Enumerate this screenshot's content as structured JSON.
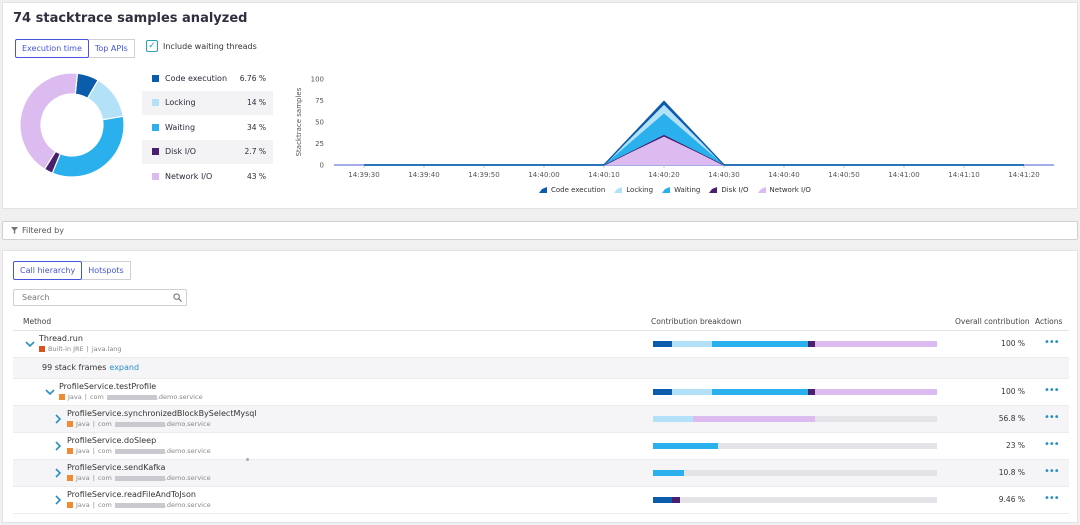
{
  "title": "74 stacktrace samples analyzed",
  "view_tabs": [
    {
      "label": "Execution time",
      "active": true
    },
    {
      "label": "Top APIs",
      "active": false
    }
  ],
  "include_waiting": {
    "label": "Include waiting threads",
    "checked": true
  },
  "categories": [
    {
      "name": "Code execution",
      "value": "6.76 %",
      "pct": 6.76,
      "color": "#0b5cab"
    },
    {
      "name": "Locking",
      "value": "14 %",
      "pct": 14,
      "color": "#b3e1f7"
    },
    {
      "name": "Waiting",
      "value": "34 %",
      "pct": 34,
      "color": "#2ab0ec"
    },
    {
      "name": "Disk I/O",
      "value": "2.7 %",
      "pct": 2.7,
      "color": "#4a1f6e"
    },
    {
      "name": "Network I/O",
      "value": "43 %",
      "pct": 43,
      "color": "#dcbcf0"
    }
  ],
  "chart_data": {
    "type": "area",
    "ylabel": "Stacktrace samples",
    "ylim": [
      0,
      100
    ],
    "yticks": [
      "100",
      "75",
      "50",
      "25",
      "0"
    ],
    "x": [
      "14:39:30",
      "14:39:40",
      "14:39:50",
      "14:40:00",
      "14:40:10",
      "14:40:20",
      "14:40:30",
      "14:40:40",
      "14:40:50",
      "14:41:00",
      "14:41:10",
      "14:41:20"
    ],
    "series": [
      {
        "name": "Network I/O",
        "values": [
          0,
          0,
          0,
          0,
          0,
          33,
          0,
          0,
          0,
          0,
          0,
          0
        ]
      },
      {
        "name": "Disk I/O",
        "values": [
          0,
          0,
          0,
          0,
          0,
          2,
          0,
          0,
          0,
          0,
          0,
          0
        ]
      },
      {
        "name": "Waiting",
        "values": [
          0,
          0,
          0,
          0,
          0,
          25,
          0,
          0,
          0,
          0,
          0,
          0
        ]
      },
      {
        "name": "Locking",
        "values": [
          0,
          0,
          0,
          0,
          0,
          10,
          0,
          0,
          0,
          0,
          0,
          0
        ]
      },
      {
        "name": "Code execution",
        "values": [
          0,
          0,
          0,
          0,
          0,
          4,
          0,
          0,
          0,
          0,
          0,
          0
        ]
      }
    ],
    "legend": [
      "Code execution",
      "Locking",
      "Waiting",
      "Disk I/O",
      "Network I/O"
    ]
  },
  "filter": {
    "label": "Filtered by"
  },
  "hier_tabs": [
    {
      "label": "Call hierarchy",
      "active": true
    },
    {
      "label": "Hotspots",
      "active": false
    }
  ],
  "search": {
    "placeholder": "Search"
  },
  "table": {
    "headers": {
      "method": "Method",
      "breakdown": "Contribution breakdown",
      "overall": "Overall contribution",
      "actions": "Actions"
    },
    "rows": [
      {
        "kind": "method",
        "name": "Thread.run",
        "lang": "Built-in JRE",
        "pkg": "java.lang",
        "redacted": false,
        "expanded": true,
        "indent": 0,
        "overall": "100 %",
        "breakdown": [
          6.76,
          14,
          34,
          2.7,
          43
        ],
        "lang_color": "#d9541e"
      },
      {
        "kind": "frames",
        "text": "99 stack frames",
        "link": "expand"
      },
      {
        "kind": "method",
        "name": "ProfileService.testProfile",
        "lang": "Java",
        "pkg": "com",
        "pkg_suffix": ".demo.service",
        "redacted": true,
        "expanded": true,
        "indent": 1,
        "overall": "100 %",
        "breakdown": [
          6.76,
          14,
          34,
          2.7,
          43
        ],
        "lang_color": "#f08b32"
      },
      {
        "kind": "method",
        "name": "ProfileService.synchronizedBlockBySelectMysql",
        "lang": "Java",
        "pkg": "com",
        "pkg_suffix": ".demo.service",
        "redacted": true,
        "expanded": false,
        "indent": 2,
        "overall": "56.8 %",
        "breakdown": [
          0,
          14,
          0,
          0,
          43
        ],
        "lang_color": "#f08b32"
      },
      {
        "kind": "method",
        "name": "ProfileService.doSleep",
        "lang": "Java",
        "pkg": "com",
        "pkg_suffix": ".demo.service",
        "redacted": true,
        "expanded": false,
        "indent": 2,
        "overall": "23 %",
        "breakdown": [
          0,
          0,
          23,
          0,
          0
        ],
        "lang_color": "#f08b32"
      },
      {
        "kind": "method",
        "name": "ProfileService.sendKafka",
        "lang": "Java",
        "pkg": "com",
        "pkg_suffix": ".demo.service",
        "redacted": true,
        "expanded": false,
        "indent": 2,
        "overall": "10.8 %",
        "breakdown": [
          0,
          0,
          10.8,
          0,
          0
        ],
        "lang_color": "#f08b32"
      },
      {
        "kind": "method",
        "name": "ProfileService.readFileAndToJson",
        "lang": "Java",
        "pkg": "com",
        "pkg_suffix": ".demo.service",
        "redacted": true,
        "expanded": false,
        "indent": 2,
        "overall": "9.46 %",
        "breakdown": [
          6.76,
          0,
          0,
          2.7,
          0
        ],
        "lang_color": "#f08b32"
      }
    ]
  },
  "icons": {
    "filter": "filter-icon",
    "search": "search-icon",
    "chevron_down": "chevron-down-icon",
    "chevron_right": "chevron-right-icon",
    "actions": "more-actions-icon",
    "check": "check-icon"
  }
}
